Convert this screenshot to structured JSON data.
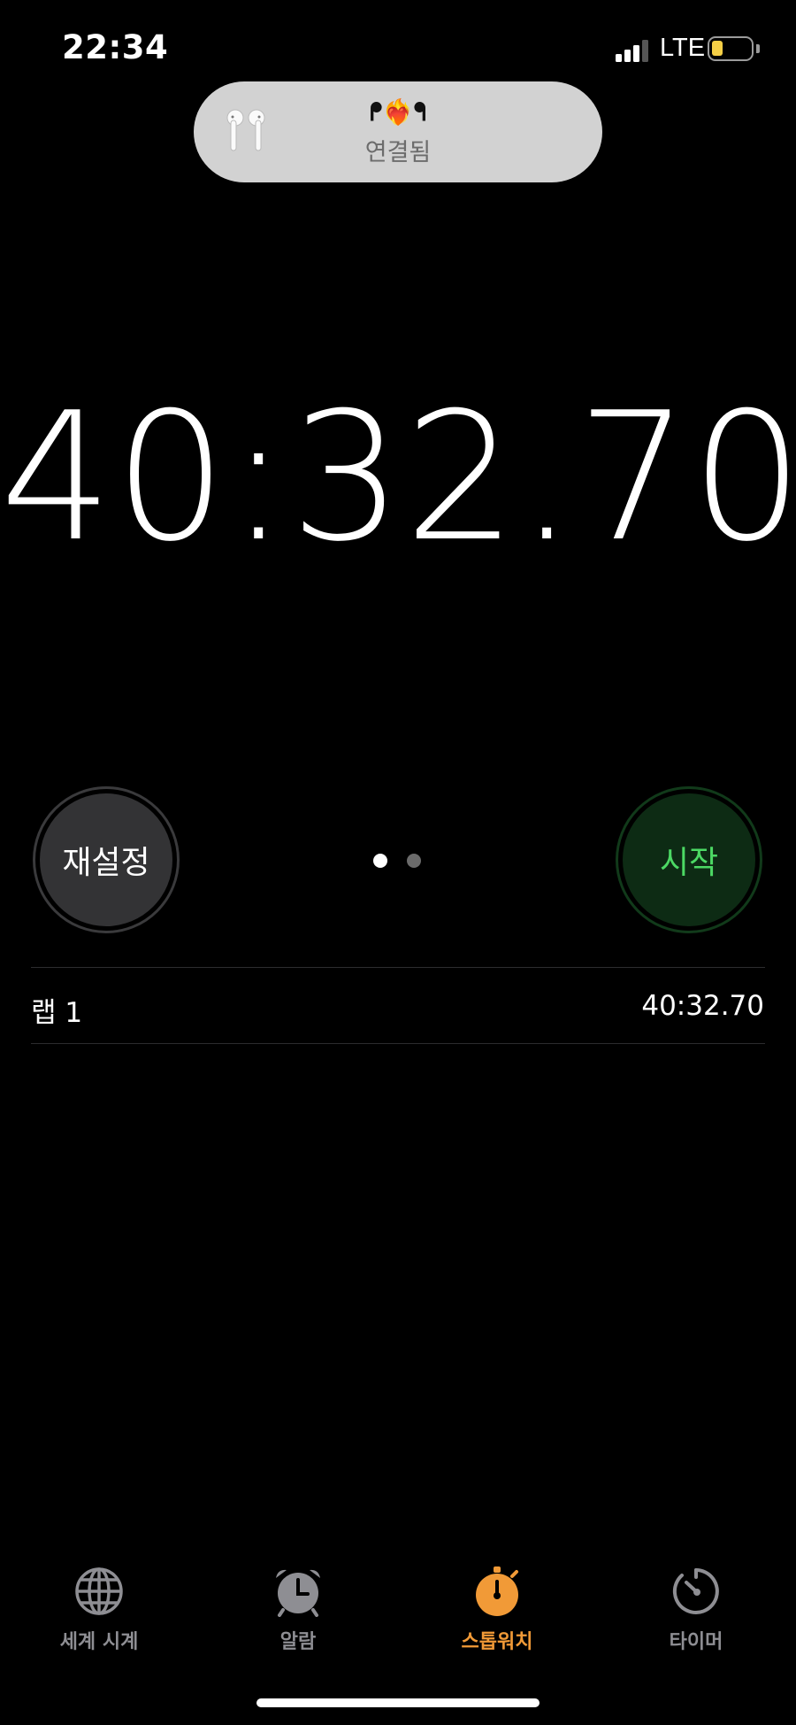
{
  "status_bar": {
    "time": "22:34",
    "network": "LTE",
    "battery_level": 0.3,
    "battery_color": "#f5cf46"
  },
  "popup": {
    "device_name_left": "ᖰ",
    "device_name_heart": "❤️‍🔥",
    "device_name_right": "ᖳ",
    "status": "연결됨",
    "icon": "airpods-icon"
  },
  "stopwatch": {
    "display": "40:32.70"
  },
  "controls": {
    "reset_label": "재설정",
    "start_label": "시작",
    "page_count": 2,
    "active_page": 1
  },
  "laps": [
    {
      "label": "랩 1",
      "time": "40:32.70"
    }
  ],
  "tabs": [
    {
      "label": "세계 시계",
      "icon": "globe-icon",
      "active": false
    },
    {
      "label": "알람",
      "icon": "alarm-clock-icon",
      "active": false
    },
    {
      "label": "스톱워치",
      "icon": "stopwatch-icon",
      "active": true
    },
    {
      "label": "타이머",
      "icon": "timer-icon",
      "active": false
    }
  ],
  "colors": {
    "accent": "#f19a37",
    "inactive_tab": "#8e8e93",
    "start_green": "#4cd964",
    "background": "#000000"
  }
}
